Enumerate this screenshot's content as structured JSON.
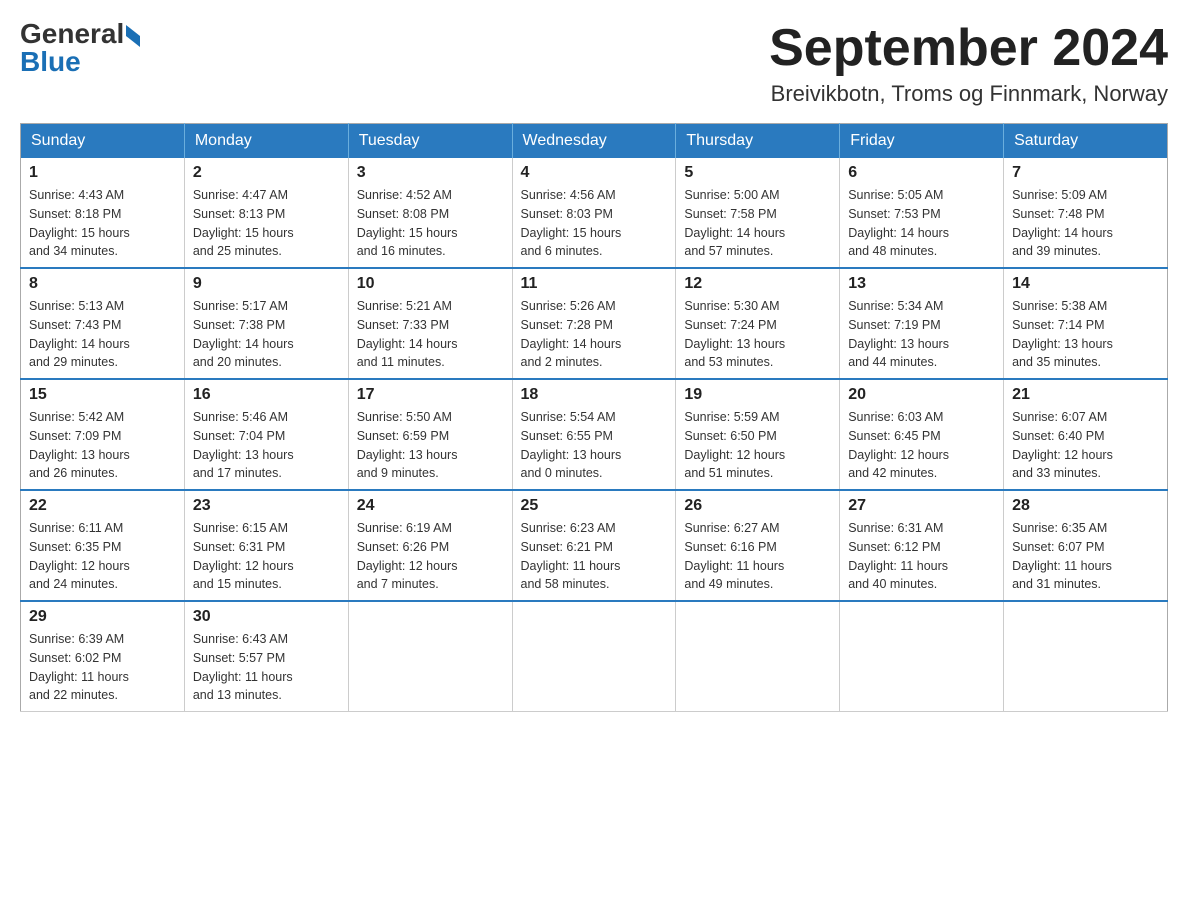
{
  "header": {
    "logo_general": "General",
    "logo_blue": "Blue",
    "month_title": "September 2024",
    "location": "Breivikbotn, Troms og Finnmark, Norway"
  },
  "weekdays": [
    "Sunday",
    "Monday",
    "Tuesday",
    "Wednesday",
    "Thursday",
    "Friday",
    "Saturday"
  ],
  "weeks": [
    [
      {
        "day": "1",
        "sunrise": "4:43 AM",
        "sunset": "8:18 PM",
        "daylight": "15 hours and 34 minutes."
      },
      {
        "day": "2",
        "sunrise": "4:47 AM",
        "sunset": "8:13 PM",
        "daylight": "15 hours and 25 minutes."
      },
      {
        "day": "3",
        "sunrise": "4:52 AM",
        "sunset": "8:08 PM",
        "daylight": "15 hours and 16 minutes."
      },
      {
        "day": "4",
        "sunrise": "4:56 AM",
        "sunset": "8:03 PM",
        "daylight": "15 hours and 6 minutes."
      },
      {
        "day": "5",
        "sunrise": "5:00 AM",
        "sunset": "7:58 PM",
        "daylight": "14 hours and 57 minutes."
      },
      {
        "day": "6",
        "sunrise": "5:05 AM",
        "sunset": "7:53 PM",
        "daylight": "14 hours and 48 minutes."
      },
      {
        "day": "7",
        "sunrise": "5:09 AM",
        "sunset": "7:48 PM",
        "daylight": "14 hours and 39 minutes."
      }
    ],
    [
      {
        "day": "8",
        "sunrise": "5:13 AM",
        "sunset": "7:43 PM",
        "daylight": "14 hours and 29 minutes."
      },
      {
        "day": "9",
        "sunrise": "5:17 AM",
        "sunset": "7:38 PM",
        "daylight": "14 hours and 20 minutes."
      },
      {
        "day": "10",
        "sunrise": "5:21 AM",
        "sunset": "7:33 PM",
        "daylight": "14 hours and 11 minutes."
      },
      {
        "day": "11",
        "sunrise": "5:26 AM",
        "sunset": "7:28 PM",
        "daylight": "14 hours and 2 minutes."
      },
      {
        "day": "12",
        "sunrise": "5:30 AM",
        "sunset": "7:24 PM",
        "daylight": "13 hours and 53 minutes."
      },
      {
        "day": "13",
        "sunrise": "5:34 AM",
        "sunset": "7:19 PM",
        "daylight": "13 hours and 44 minutes."
      },
      {
        "day": "14",
        "sunrise": "5:38 AM",
        "sunset": "7:14 PM",
        "daylight": "13 hours and 35 minutes."
      }
    ],
    [
      {
        "day": "15",
        "sunrise": "5:42 AM",
        "sunset": "7:09 PM",
        "daylight": "13 hours and 26 minutes."
      },
      {
        "day": "16",
        "sunrise": "5:46 AM",
        "sunset": "7:04 PM",
        "daylight": "13 hours and 17 minutes."
      },
      {
        "day": "17",
        "sunrise": "5:50 AM",
        "sunset": "6:59 PM",
        "daylight": "13 hours and 9 minutes."
      },
      {
        "day": "18",
        "sunrise": "5:54 AM",
        "sunset": "6:55 PM",
        "daylight": "13 hours and 0 minutes."
      },
      {
        "day": "19",
        "sunrise": "5:59 AM",
        "sunset": "6:50 PM",
        "daylight": "12 hours and 51 minutes."
      },
      {
        "day": "20",
        "sunrise": "6:03 AM",
        "sunset": "6:45 PM",
        "daylight": "12 hours and 42 minutes."
      },
      {
        "day": "21",
        "sunrise": "6:07 AM",
        "sunset": "6:40 PM",
        "daylight": "12 hours and 33 minutes."
      }
    ],
    [
      {
        "day": "22",
        "sunrise": "6:11 AM",
        "sunset": "6:35 PM",
        "daylight": "12 hours and 24 minutes."
      },
      {
        "day": "23",
        "sunrise": "6:15 AM",
        "sunset": "6:31 PM",
        "daylight": "12 hours and 15 minutes."
      },
      {
        "day": "24",
        "sunrise": "6:19 AM",
        "sunset": "6:26 PM",
        "daylight": "12 hours and 7 minutes."
      },
      {
        "day": "25",
        "sunrise": "6:23 AM",
        "sunset": "6:21 PM",
        "daylight": "11 hours and 58 minutes."
      },
      {
        "day": "26",
        "sunrise": "6:27 AM",
        "sunset": "6:16 PM",
        "daylight": "11 hours and 49 minutes."
      },
      {
        "day": "27",
        "sunrise": "6:31 AM",
        "sunset": "6:12 PM",
        "daylight": "11 hours and 40 minutes."
      },
      {
        "day": "28",
        "sunrise": "6:35 AM",
        "sunset": "6:07 PM",
        "daylight": "11 hours and 31 minutes."
      }
    ],
    [
      {
        "day": "29",
        "sunrise": "6:39 AM",
        "sunset": "6:02 PM",
        "daylight": "11 hours and 22 minutes."
      },
      {
        "day": "30",
        "sunrise": "6:43 AM",
        "sunset": "5:57 PM",
        "daylight": "11 hours and 13 minutes."
      },
      null,
      null,
      null,
      null,
      null
    ]
  ],
  "labels": {
    "sunrise": "Sunrise:",
    "sunset": "Sunset:",
    "daylight": "Daylight:"
  }
}
